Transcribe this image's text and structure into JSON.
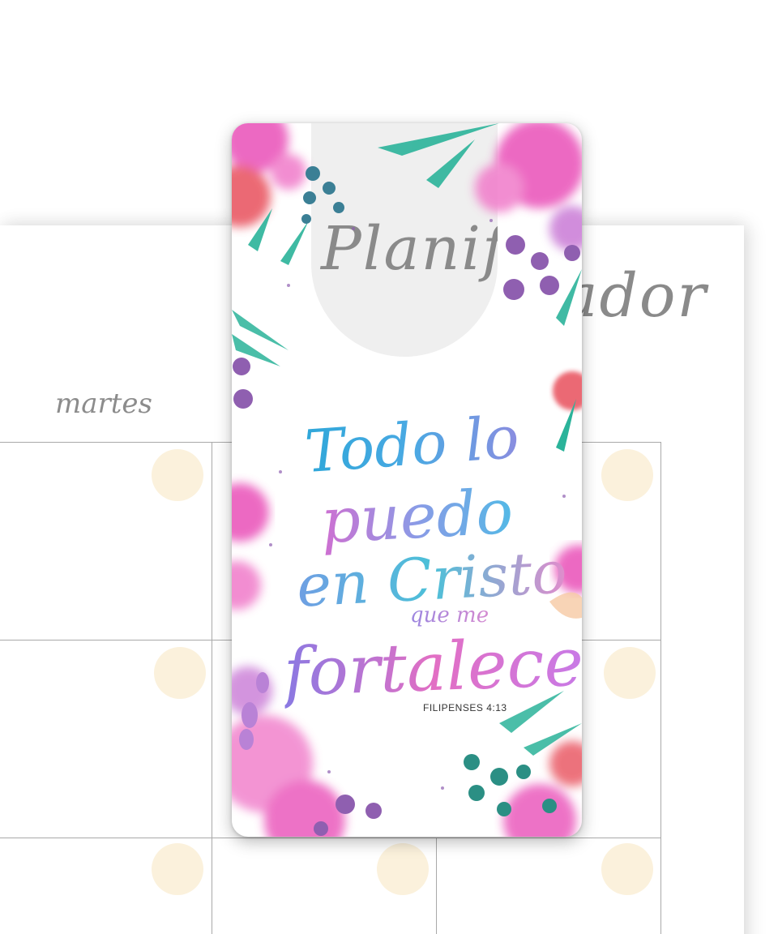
{
  "planner": {
    "brand": "Planificador",
    "day_label": "martes"
  },
  "bookmark": {
    "verse_lines": [
      "Todo lo",
      "puedo",
      "en Cristo",
      "que me",
      "fortalece"
    ],
    "reference": "FILIPENSES 4:13"
  },
  "colors": {
    "page_background": "#ffffff",
    "grid_line": "#a9a9a9",
    "dot": "#fbf1dc",
    "brand_text": "#8a8a8a",
    "notch": "#efefef",
    "watercolor_pink": "#e94fb8",
    "watercolor_teal": "#2bb39a",
    "watercolor_purple": "#8f5fb0",
    "watercolor_red": "#e8505b"
  },
  "icons": [
    "watercolor-floral-illustration"
  ]
}
